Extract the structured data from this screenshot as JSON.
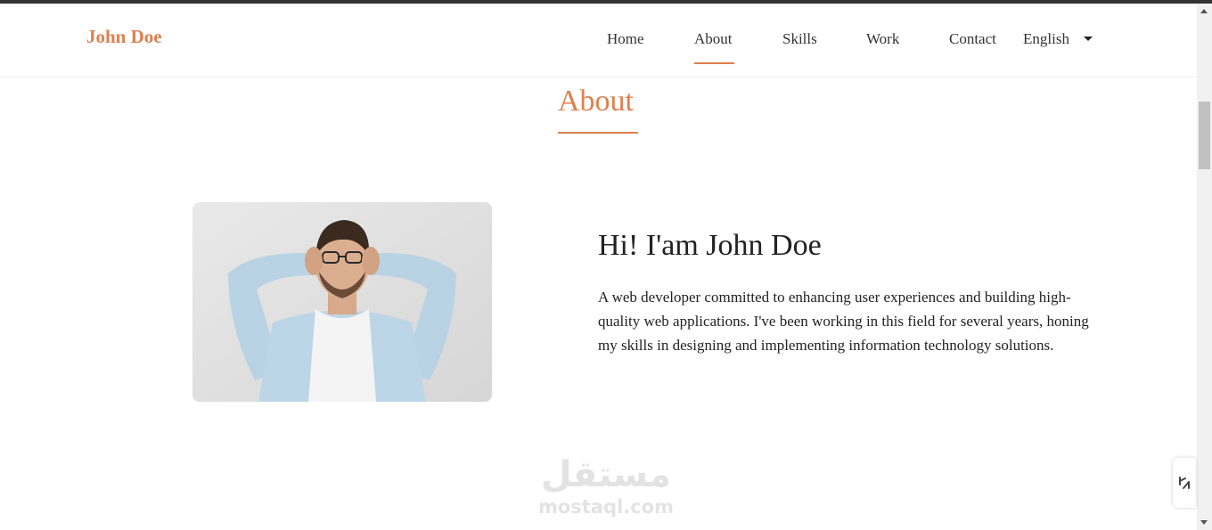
{
  "brand": "John Doe",
  "nav": {
    "items": [
      {
        "label": "Home"
      },
      {
        "label": "About",
        "active": true
      },
      {
        "label": "Skills"
      },
      {
        "label": "Work"
      },
      {
        "label": "Contact"
      }
    ],
    "language": "English"
  },
  "section": {
    "title": "About"
  },
  "about": {
    "heading": "Hi! I'am John Doe",
    "bio": "A web developer committed to enhancing user experiences and building high-quality web applications. I've been working in this field for several years, honing my skills in designing and implementing information technology solutions."
  },
  "watermark": {
    "arabic": "مستقل",
    "latin": "mostaql.com"
  },
  "colors": {
    "accent": "#e07f4d",
    "text": "#222222"
  },
  "icons": {
    "language_dropdown": "caret-down-icon",
    "float_widget": "link-icon"
  }
}
